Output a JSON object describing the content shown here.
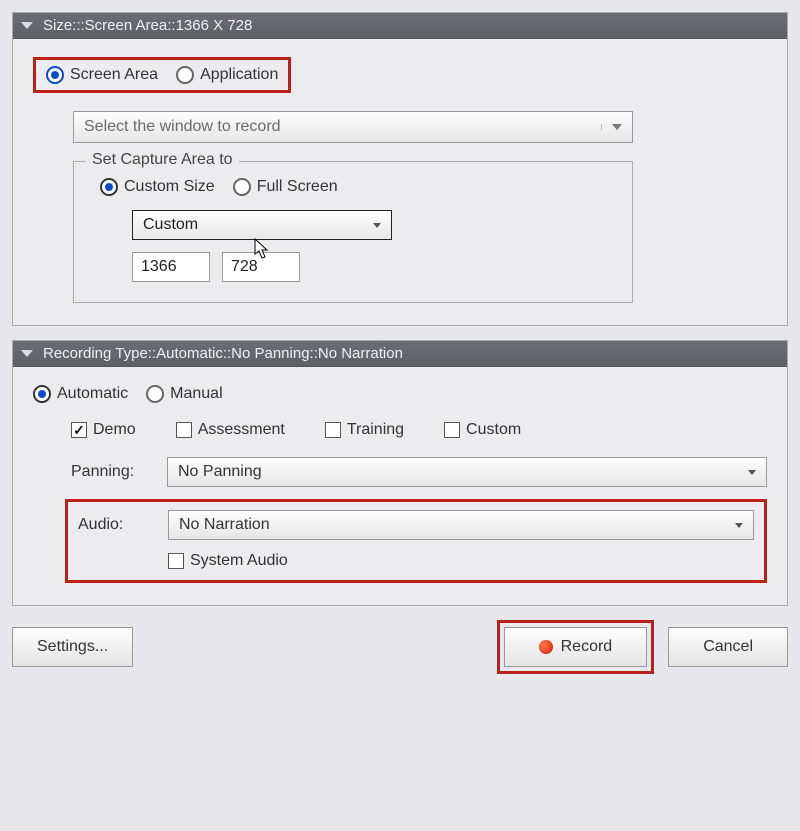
{
  "panel1": {
    "title": "Size:::Screen Area::1366 X 728",
    "radio_screen_area": "Screen Area",
    "radio_application": "Application",
    "window_select_placeholder": "Select the window to record",
    "capture_legend": "Set Capture Area to",
    "radio_custom_size": "Custom Size",
    "radio_full_screen": "Full Screen",
    "size_preset": "Custom",
    "width_value": "1366",
    "height_value": "728"
  },
  "panel2": {
    "title": "Recording Type::Automatic::No Panning::No Narration",
    "radio_automatic": "Automatic",
    "radio_manual": "Manual",
    "chk_demo": "Demo",
    "chk_assessment": "Assessment",
    "chk_training": "Training",
    "chk_custom": "Custom",
    "panning_label": "Panning:",
    "panning_value": "No Panning",
    "audio_label": "Audio:",
    "audio_value": "No Narration",
    "chk_system_audio": "System Audio"
  },
  "footer": {
    "settings": "Settings...",
    "record": "Record",
    "cancel": "Cancel"
  }
}
